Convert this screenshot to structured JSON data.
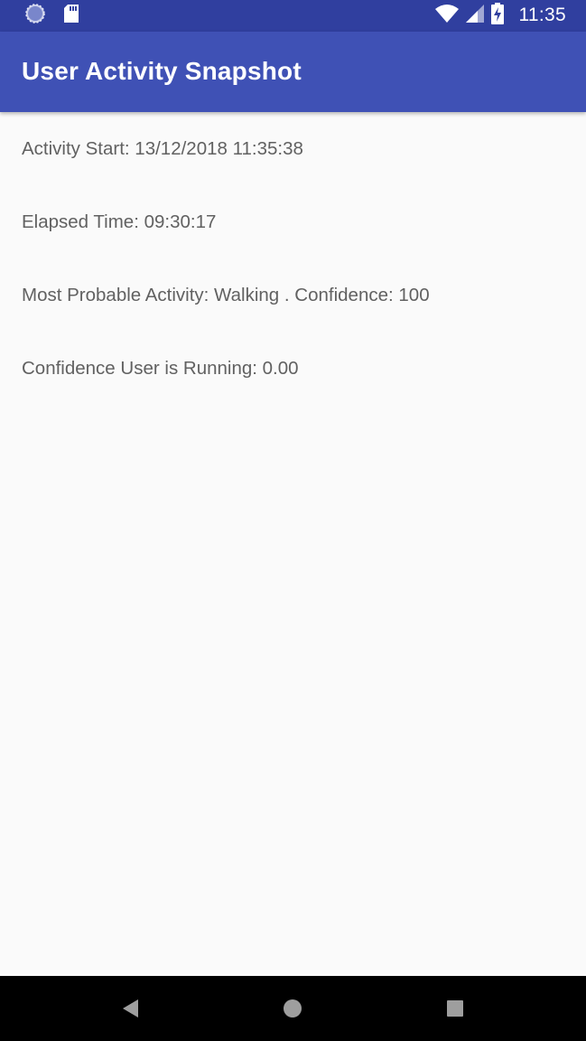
{
  "status_bar": {
    "time": "11:35",
    "icons": [
      "sync-icon",
      "sd-card-icon",
      "wifi-icon",
      "cell-signal-icon",
      "battery-charging-icon"
    ]
  },
  "app_bar": {
    "title": "User Activity Snapshot"
  },
  "content": {
    "activity_start": "Activity Start: 13/12/2018 11:35:38",
    "elapsed_time": "Elapsed Time: 09:30:17",
    "most_probable": "Most Probable Activity: Walking . Confidence: 100",
    "running_confidence": "Confidence User is Running: 0.00"
  },
  "nav_bar": {
    "buttons": [
      "back-icon",
      "home-icon",
      "recents-icon"
    ]
  },
  "colors": {
    "status_bar": "#303f9f",
    "app_bar": "#3f51b5",
    "background": "#fafafa",
    "text": "#616161"
  }
}
